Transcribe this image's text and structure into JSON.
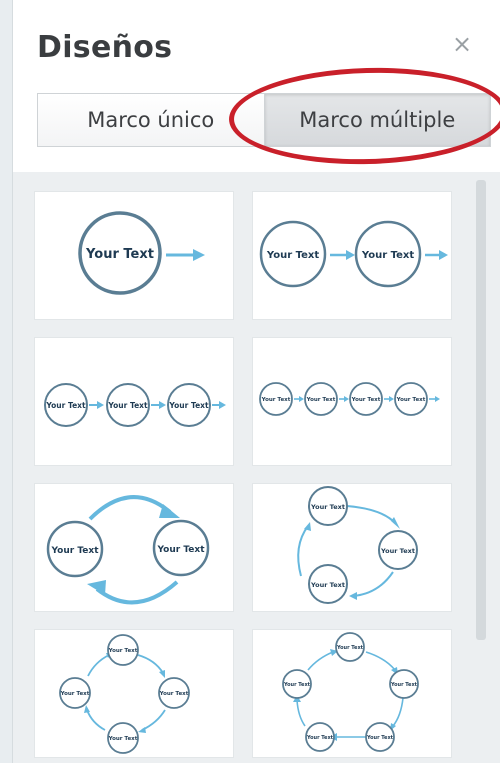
{
  "panel": {
    "title": "Diseños",
    "close_icon": "close-icon",
    "close_glyph": "×"
  },
  "tabs": [
    {
      "label": "Marco único",
      "active": false
    },
    {
      "label": "Marco múltiple",
      "active": true
    }
  ],
  "highlight_color": "#c9202a",
  "accent_color": "#66b8de",
  "gallery": {
    "layouts": [
      {
        "name": "single-frame",
        "frames": 1,
        "text": "Your Text"
      },
      {
        "name": "two-frames-row",
        "frames": 2,
        "text": "Your Text"
      },
      {
        "name": "three-frames-row",
        "frames": 3,
        "text": "Your Text"
      },
      {
        "name": "four-frames-row",
        "frames": 4,
        "text": "Your Text"
      },
      {
        "name": "two-frames-cycle",
        "frames": 2,
        "text": "Your Text"
      },
      {
        "name": "three-frames-cycle",
        "frames": 3,
        "text": "Your Text"
      },
      {
        "name": "four-frames-cycle",
        "frames": 4,
        "text": "Your Text"
      },
      {
        "name": "five-frames-cycle",
        "frames": 5,
        "text": "Your Text"
      }
    ]
  }
}
